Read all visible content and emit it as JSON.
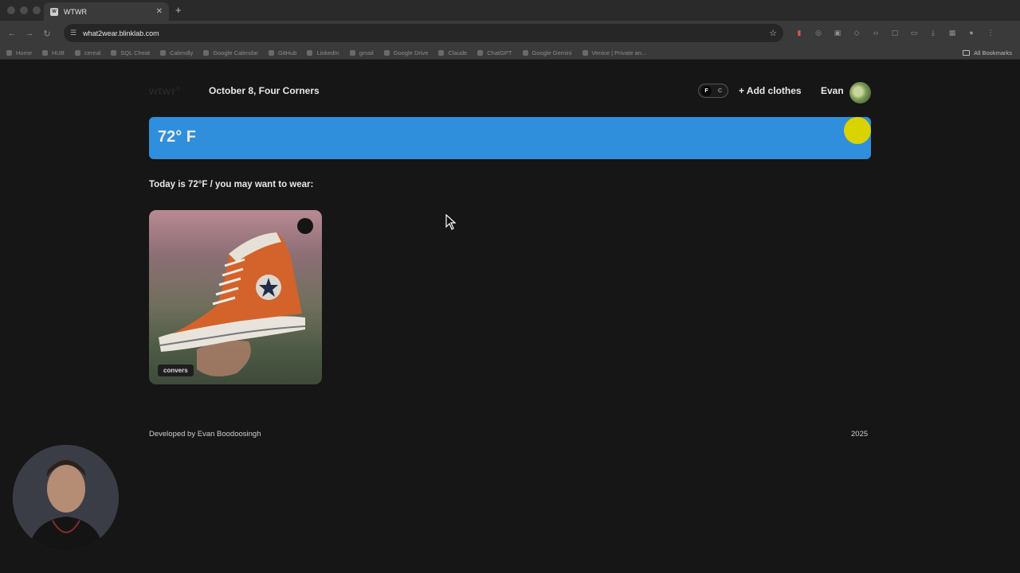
{
  "browser": {
    "tab_title": "WTWR",
    "favicon_text": "W",
    "url": "what2wear.blinklab.com",
    "bookmarks": [
      "Home",
      "HUB",
      "cereal",
      "SQL Cheat",
      "Calendly",
      "Google Calendar",
      "GitHub",
      "LinkedIn",
      "gmail",
      "Google Drive",
      "Claude",
      "ChatGPT",
      "Google Gemini",
      "Venice | Private an..."
    ],
    "all_bookmarks_label": "All Bookmarks"
  },
  "header": {
    "logo": "wtwr°",
    "date_location": "October 8, Four Corners",
    "unit_toggle": {
      "active": "F",
      "inactive": "C"
    },
    "add_clothes_label": "+ Add clothes",
    "user_name": "Evan"
  },
  "weather": {
    "temperature_label": "72° F",
    "bar_color": "#2f8fdc",
    "sun_color": "#d9d300"
  },
  "suggestion_text": "Today is 72°F / you may want to wear:",
  "items": [
    {
      "name": "convers",
      "icon": "high-top-sneaker"
    }
  ],
  "footer": {
    "developer": "Developed by Evan Boodoosingh",
    "year": "2025"
  }
}
